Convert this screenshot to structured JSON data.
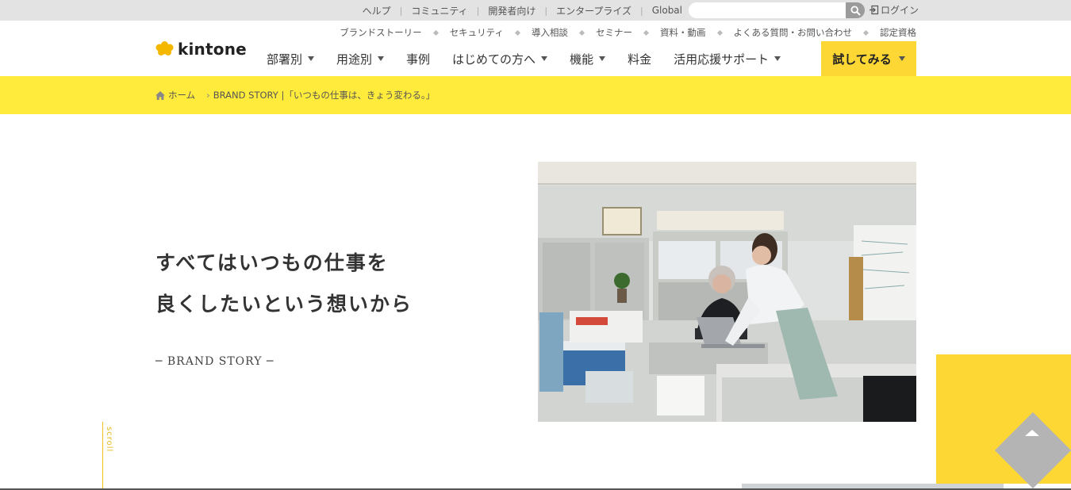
{
  "utility": {
    "links": [
      "ヘルプ",
      "コミュニティ",
      "開発者向け",
      "エンタープライズ",
      "Global"
    ],
    "search_placeholder": "",
    "login_label": "ログイン"
  },
  "header": {
    "logo_text": "kintone",
    "sub_nav": [
      "ブランドストーリー",
      "セキュリティ",
      "導入相談",
      "セミナー",
      "資料・動画",
      "よくある質問・お問い合わせ",
      "認定資格"
    ],
    "main_nav": [
      {
        "label": "部署別",
        "dropdown": true
      },
      {
        "label": "用途別",
        "dropdown": true
      },
      {
        "label": "事例",
        "dropdown": false
      },
      {
        "label": "はじめての方へ",
        "dropdown": true
      },
      {
        "label": "機能",
        "dropdown": true
      },
      {
        "label": "料金",
        "dropdown": false
      },
      {
        "label": "活用応援サポート",
        "dropdown": true
      }
    ],
    "cta_label": "試してみる"
  },
  "breadcrumb": {
    "home": "ホーム",
    "current": "BRAND STORY |「いつもの仕事は、きょう変わる。」"
  },
  "hero": {
    "title_line1": "すべてはいつもの仕事を",
    "title_line2": "良くしたいという想いから",
    "subtitle": "─ BRAND STORY ─"
  },
  "scroll_label": "scroll",
  "colors": {
    "accent_yellow": "#ffeb3b",
    "cta_yellow": "#fdd835",
    "utility_bg": "#e3e3e3"
  }
}
